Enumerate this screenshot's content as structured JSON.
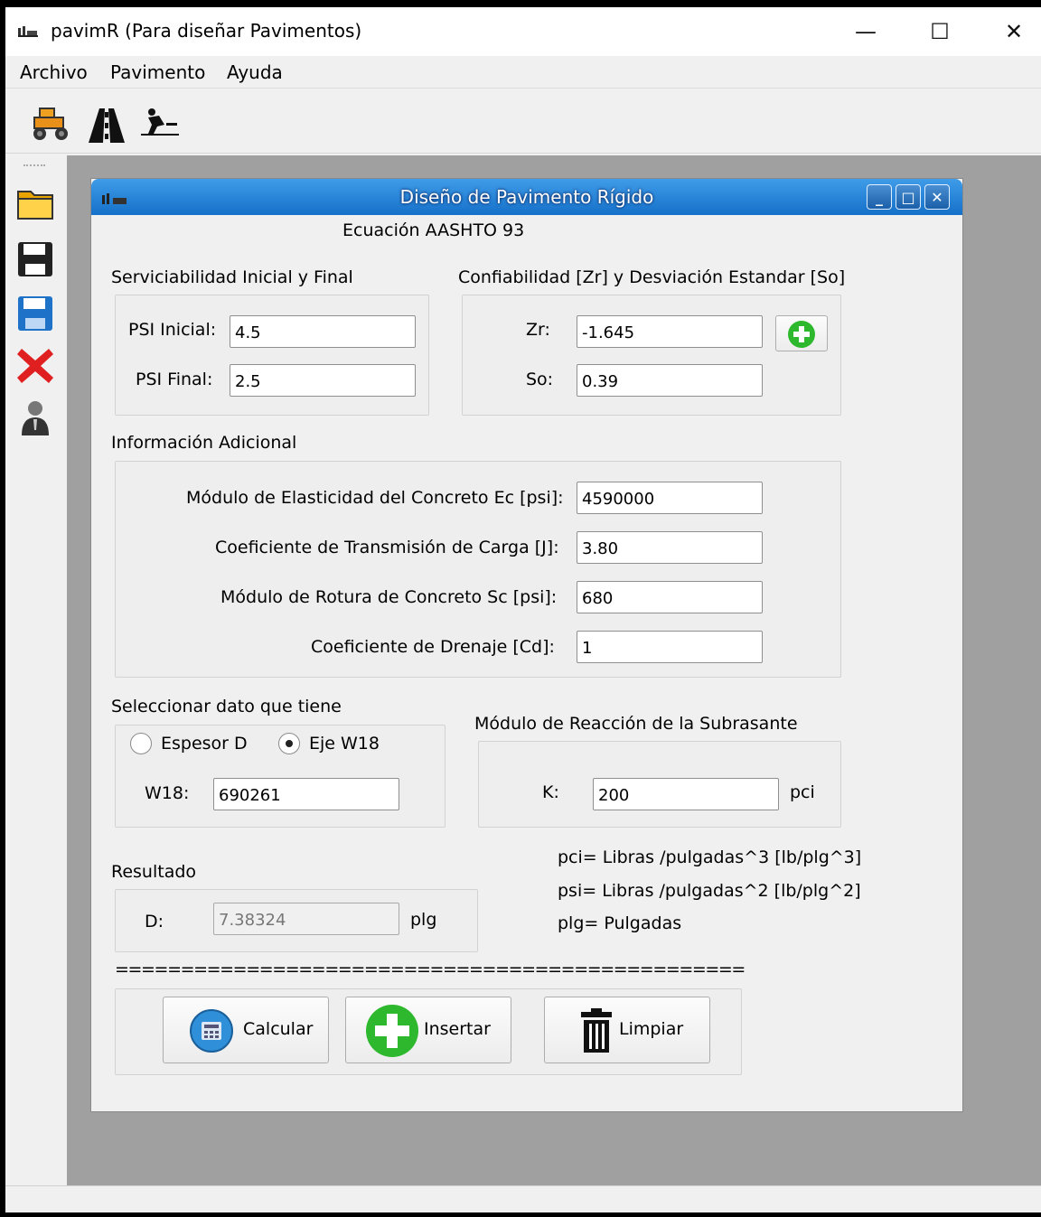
{
  "window": {
    "title": "pavimR (Para diseñar Pavimentos)",
    "minimize_glyph": "—",
    "maximize_glyph": "☐",
    "close_glyph": "✕"
  },
  "menu": {
    "items": [
      "Archivo",
      "Pavimento",
      "Ayuda"
    ]
  },
  "toolbar": {
    "icons": [
      "road-roller-icon",
      "road-icon",
      "worker-icon"
    ]
  },
  "sidebar": {
    "icons": [
      "open-folder-icon",
      "save-icon",
      "save-as-icon",
      "delete-icon",
      "user-icon"
    ]
  },
  "dialog": {
    "title": "Diseño de Pavimento Rígido",
    "subtitle": "Ecuación AASHTO 93",
    "serviciabilidad": {
      "heading": "Serviciabilidad Inicial y Final",
      "psi_inicial_label": "PSI Inicial:",
      "psi_inicial_value": "4.5",
      "psi_final_label": "PSI Final:",
      "psi_final_value": "2.5"
    },
    "confiabilidad": {
      "heading": "Confiabilidad [Zr] y Desviación Estandar [So]",
      "zr_label": "Zr:",
      "zr_value": "-1.645",
      "so_label": "So:",
      "so_value": "0.39"
    },
    "info": {
      "heading": "Información Adicional",
      "ec_label": "Módulo de  Elasticidad del Concreto Ec [psi]:",
      "ec_value": "4590000",
      "j_label": "Coeficiente de Transmisión de Carga [J]:",
      "j_value": "3.80",
      "sc_label": "Módulo de Rotura de Concreto  Sc [psi]:",
      "sc_value": "680",
      "cd_label": "Coeficiente de Drenaje [Cd]:",
      "cd_value": "1"
    },
    "seleccion": {
      "heading": "Seleccionar  dato que tiene",
      "espesor_label": "Espesor D",
      "eje_label": "Eje W18",
      "selected": "Eje W18",
      "w18_label": "W18:",
      "w18_value": "690261"
    },
    "modulo": {
      "heading": "Módulo de Reacción de la Subrasante",
      "k_label": "K:",
      "k_value": "200",
      "k_unit": "pci"
    },
    "resultado": {
      "heading": "Resultado",
      "d_label": "D:",
      "d_value": "7.38324",
      "d_unit": "plg"
    },
    "notes": {
      "pci": "pci= Libras /pulgadas^3 [lb/plg^3]",
      "psi": "psi= Libras /pulgadas^2 [lb/plg^2]",
      "plg": "plg= Pulgadas"
    },
    "separator": "================================================",
    "buttons": {
      "calcular": "Calcular",
      "insertar": "Insertar",
      "limpiar": "Limpiar"
    },
    "colors": {
      "titlebar": "#1570c9",
      "add_green": "#2eb82e"
    }
  }
}
